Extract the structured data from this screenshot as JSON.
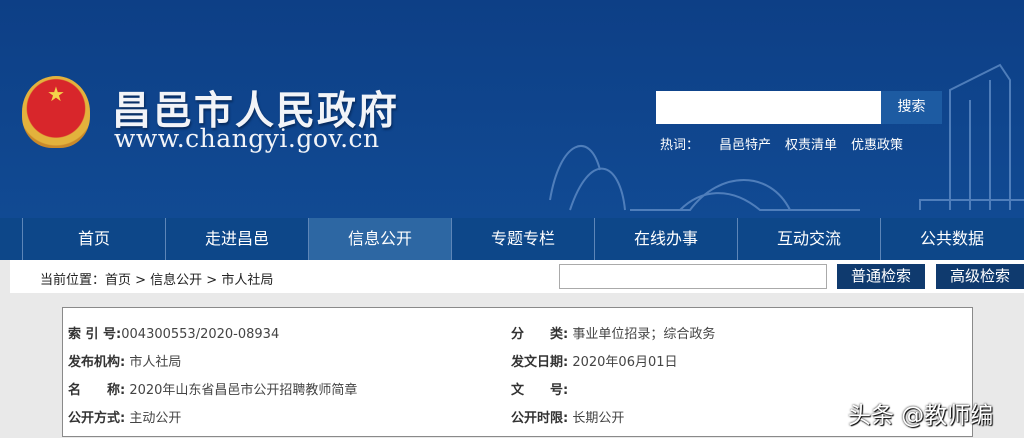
{
  "header": {
    "title": "昌邑市人民政府",
    "url": "www.changyi.gov.cn",
    "search_button": "搜索",
    "hot_label": "热词：",
    "hot_words": [
      "昌邑特产",
      "权责清单",
      "优惠政策"
    ]
  },
  "nav": [
    "首页",
    "走进昌邑",
    "信息公开",
    "专题专栏",
    "在线办事",
    "互动交流",
    "公共数据"
  ],
  "breadcrumb": {
    "text": "当前位置：首页 > 信息公开 > 市人社局",
    "normal_search": "普通检索",
    "advanced_search": "高级检索"
  },
  "info": {
    "index_label": "索 引 号:",
    "index": "004300553/2020-08934",
    "category_label": "分　　类:",
    "category": "事业单位招录；综合政务",
    "publisher_label": "发布机构:",
    "publisher": "市人社局",
    "date_label": "发文日期:",
    "date": "2020年06月01日",
    "name_label": "名　　称:",
    "name": "2020年山东省昌邑市公开招聘教师简章",
    "docno_label": "文　　号:",
    "docno": "",
    "method_label": "公开方式:",
    "method": "主动公开",
    "period_label": "公开时限:",
    "period": "长期公开"
  },
  "watermark": "头条 @教师编",
  "colors": {
    "header": "#114a93",
    "nav": "#0d4789",
    "nav_active": "#2d67a3",
    "button": "#0f3a6e"
  }
}
